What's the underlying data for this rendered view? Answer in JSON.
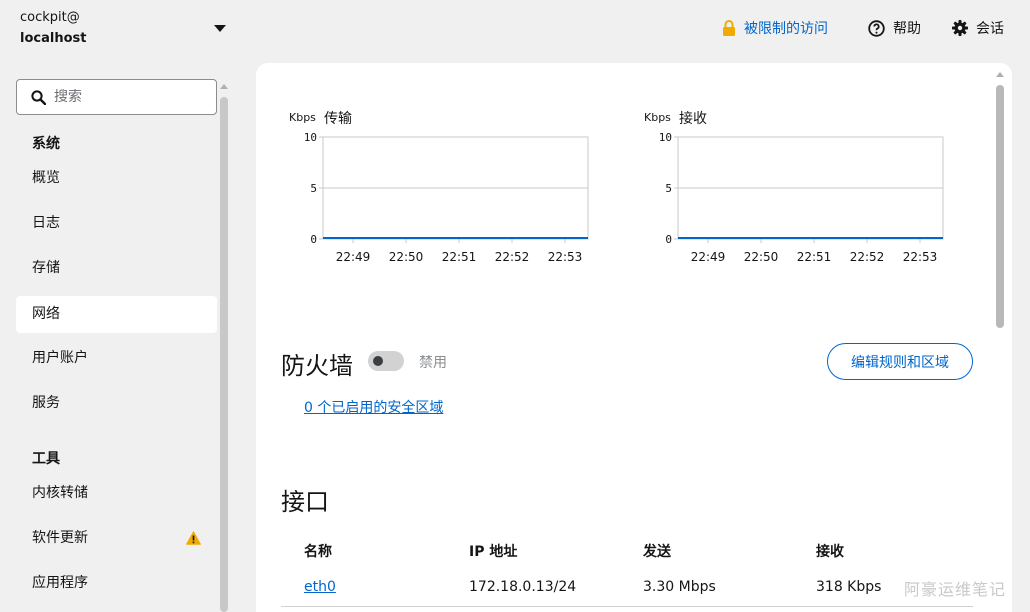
{
  "header": {
    "user": "cockpit@",
    "host": "localhost",
    "limited_access": "被限制的访问",
    "help": "帮助",
    "session": "会话"
  },
  "sidebar": {
    "search_placeholder": "搜索",
    "system_heading": "系统",
    "system_items": [
      "概览",
      "日志",
      "存储",
      "网络",
      "用户账户",
      "服务"
    ],
    "active_item": "网络",
    "tools_heading": "工具",
    "tools_items": [
      "内核转储",
      "软件更新",
      "应用程序"
    ],
    "warning_item": "软件更新"
  },
  "chart_data": [
    {
      "type": "line",
      "title": "传输",
      "ylabel": "Kbps",
      "categories": [
        "22:49",
        "22:50",
        "22:51",
        "22:52",
        "22:53"
      ],
      "yticks": [
        "10",
        "5",
        "0"
      ],
      "ylim": [
        0,
        10
      ],
      "series": [
        {
          "values": [
            0,
            0,
            0,
            0,
            0,
            0
          ]
        }
      ]
    },
    {
      "type": "line",
      "title": "接收",
      "ylabel": "Kbps",
      "categories": [
        "22:49",
        "22:50",
        "22:51",
        "22:52",
        "22:53"
      ],
      "yticks": [
        "10",
        "5",
        "0"
      ],
      "ylim": [
        0,
        10
      ],
      "series": [
        {
          "values": [
            0,
            0,
            0,
            0,
            0,
            0
          ]
        }
      ]
    }
  ],
  "firewall": {
    "title": "防火墙",
    "state": "禁用",
    "enabled": false,
    "edit_button": "编辑规则和区域",
    "zones_link": "0 个已启用的安全区域"
  },
  "interfaces": {
    "title": "接口",
    "headers": [
      "名称",
      "IP 地址",
      "发送",
      "接收"
    ],
    "rows": [
      {
        "name": "eth0",
        "ip": "172.18.0.13/24",
        "sent": "3.30 Mbps",
        "received": "318 Kbps"
      }
    ]
  },
  "watermark": "阿豪运维笔记",
  "colors": {
    "accent": "#0066cc",
    "warning": "#f0ab00",
    "lock": "#f0ab00",
    "chart_line": "#0066cc"
  }
}
